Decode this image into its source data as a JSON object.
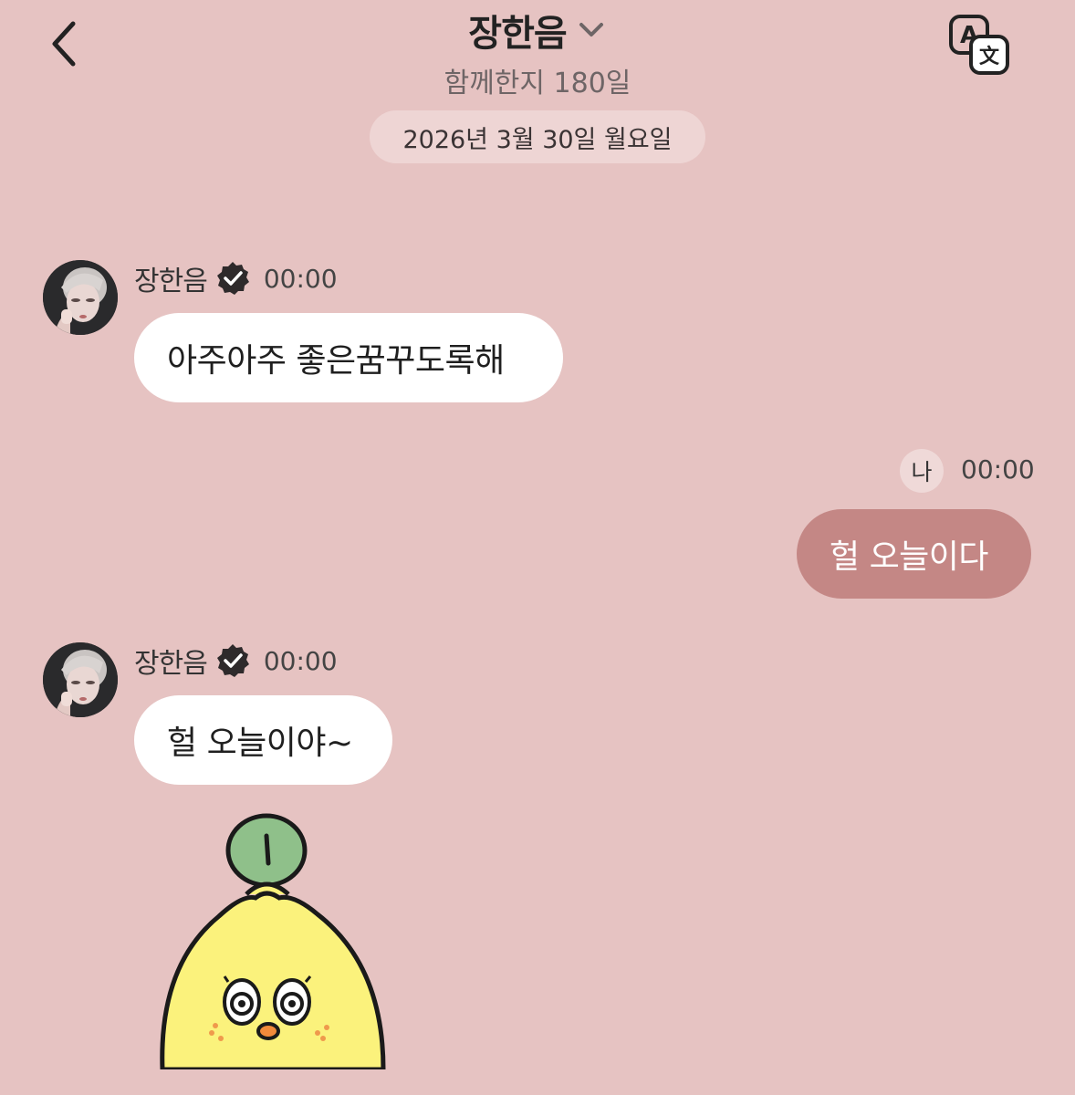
{
  "header": {
    "title": "장한음",
    "subtitle": "함께한지 180일",
    "back_icon": "chevron-left-icon",
    "translate_icon": "translate-icon"
  },
  "date_divider": "2026년 3월 30일 월요일",
  "messages": [
    {
      "direction": "incoming",
      "sender": "장한음",
      "verified": true,
      "time": "00:00",
      "text": "아주아주 좋은꿈꾸도록해"
    },
    {
      "direction": "outgoing",
      "sender": "나",
      "time": "00:00",
      "text": "헐 오늘이다"
    },
    {
      "direction": "incoming",
      "sender": "장한음",
      "verified": true,
      "time": "00:00",
      "text": "헐 오늘이야~"
    },
    {
      "direction": "incoming",
      "type": "sticker",
      "sticker": "lemon-character-sticker"
    }
  ],
  "colors": {
    "background": "#e6c3c2",
    "outgoing_bubble": "#c48785",
    "incoming_bubble": "#ffffff",
    "date_pill": "#eed5d4"
  }
}
